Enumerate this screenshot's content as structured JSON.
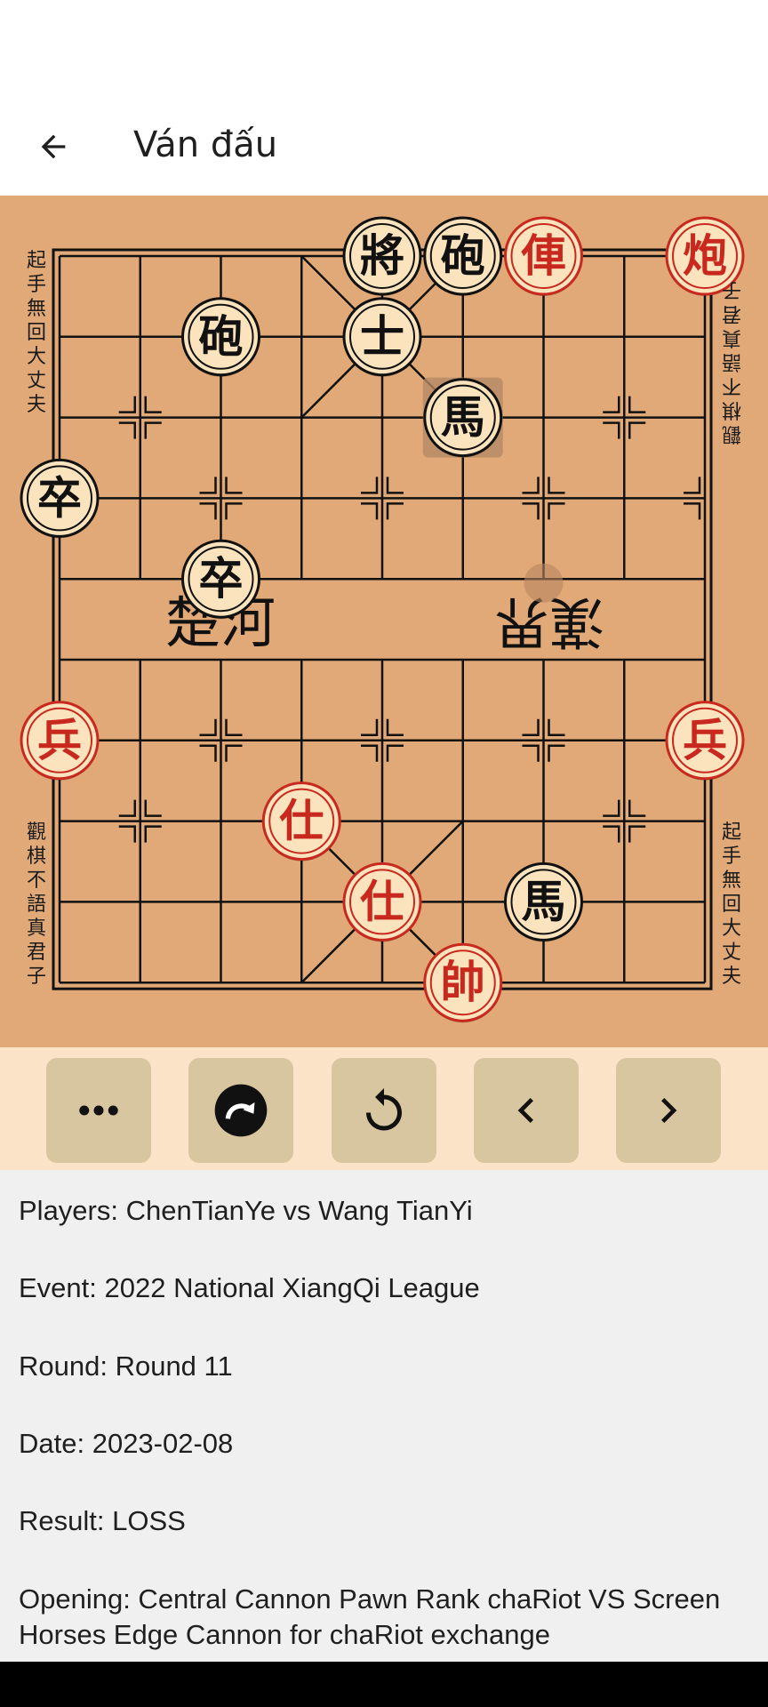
{
  "app_bar": {
    "title": "Ván đấu",
    "back_icon": "arrow-left-icon"
  },
  "board": {
    "river_left": "楚河",
    "river_right": "漢界",
    "side_texts": {
      "top_left": "起手無回大丈夫",
      "top_right": "觀棋不語真君子",
      "bottom_left": "觀棋不語真君子",
      "bottom_right": "起手無回大丈夫"
    },
    "colors": {
      "board": "#e0a977",
      "red": "#c8281e",
      "black": "#111111",
      "piece_face": "#fbe3bd"
    },
    "pieces": [
      {
        "char": "將",
        "side": "black",
        "col": 4,
        "row": 0
      },
      {
        "char": "砲",
        "side": "black",
        "col": 5,
        "row": 0
      },
      {
        "char": "俥",
        "side": "red",
        "col": 6,
        "row": 0
      },
      {
        "char": "炮",
        "side": "red",
        "col": 8,
        "row": 0
      },
      {
        "char": "砲",
        "side": "black",
        "col": 2,
        "row": 1
      },
      {
        "char": "士",
        "side": "black",
        "col": 4,
        "row": 1
      },
      {
        "char": "馬",
        "side": "black",
        "col": 5,
        "row": 2,
        "highlight": true
      },
      {
        "char": "卒",
        "side": "black",
        "col": 0,
        "row": 3
      },
      {
        "char": "卒",
        "side": "black",
        "col": 2,
        "row": 4
      },
      {
        "char": "兵",
        "side": "red",
        "col": 0,
        "row": 6
      },
      {
        "char": "兵",
        "side": "red",
        "col": 8,
        "row": 6
      },
      {
        "char": "仕",
        "side": "red",
        "col": 3,
        "row": 7
      },
      {
        "char": "仕",
        "side": "red",
        "col": 4,
        "row": 8
      },
      {
        "char": "馬",
        "side": "black",
        "col": 6,
        "row": 8
      },
      {
        "char": "帥",
        "side": "red",
        "col": 5,
        "row": 9
      }
    ],
    "last_move_dot": {
      "col": 6,
      "row": 4.05
    }
  },
  "controls": [
    {
      "name": "more-button",
      "icon": "more-horizontal-icon"
    },
    {
      "name": "redo-button",
      "icon": "redo-circle-icon"
    },
    {
      "name": "restart-button",
      "icon": "rotate-icon"
    },
    {
      "name": "prev-button",
      "icon": "chevron-left-icon"
    },
    {
      "name": "next-button",
      "icon": "chevron-right-icon"
    }
  ],
  "info": {
    "players": "Players: ChenTianYe vs Wang TianYi",
    "event": "Event: 2022 National XiangQi League",
    "round": "Round: Round 11",
    "date": "Date: 2023-02-08",
    "result": "Result: LOSS",
    "opening": "Opening: Central Cannon Pawn Rank chaRiot VS Screen Horses Edge Cannon for chaRiot exchange"
  }
}
